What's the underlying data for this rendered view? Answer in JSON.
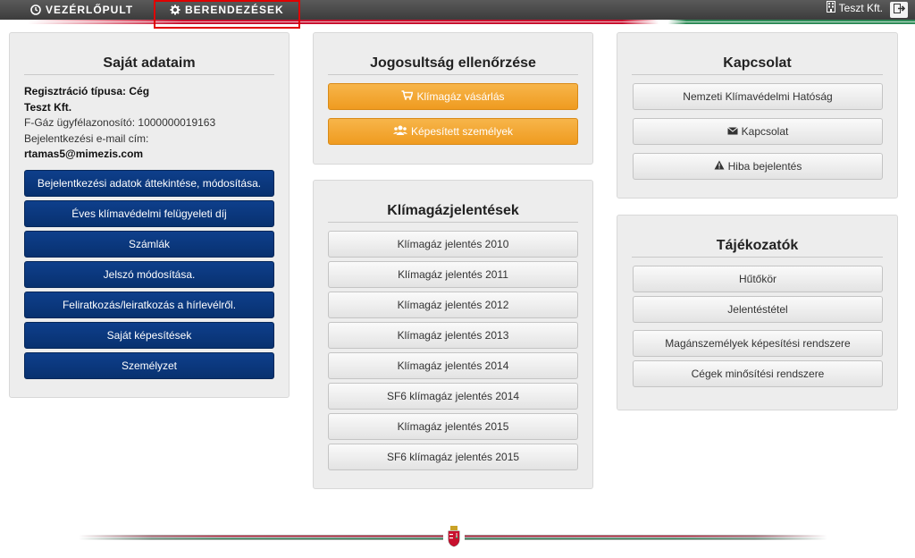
{
  "nav": {
    "dashboard_label": "VEZÉRLŐPULT",
    "equipment_label": "BERENDEZÉSEK",
    "company_name": "Teszt Kft."
  },
  "own_data": {
    "title": "Saját adataim",
    "reg_type": "Regisztráció típusa: Cég",
    "company": "Teszt Kft.",
    "fgas_id": "F-Gáz ügyfélazonosító: 1000000019163",
    "email_label": "Bejelentkezési e-mail cím:",
    "email": "rtamas5@mimezis.com",
    "buttons": [
      "Bejelentkezési adatok áttekintése, módosítása.",
      "Éves klímavédelmi felügyeleti díj",
      "Számlák",
      "Jelszó módosítása.",
      "Feliratkozás/leiratkozás a hírlevélről.",
      "Saját képesítések",
      "Személyzet"
    ]
  },
  "eligibility": {
    "title": "Jogosultság ellenőrzése",
    "buttons": [
      "Klímagáz vásárlás",
      "Képesített személyek"
    ]
  },
  "reports": {
    "title": "Klímagázjelentések",
    "buttons": [
      "Klímagáz jelentés 2010",
      "Klímagáz jelentés 2011",
      "Klímagáz jelentés 2012",
      "Klímagáz jelentés 2013",
      "Klímagáz jelentés 2014",
      "SF6 klímagáz jelentés 2014",
      "Klímagáz jelentés 2015",
      "SF6 klímagáz jelentés 2015"
    ]
  },
  "contact": {
    "title": "Kapcsolat",
    "buttons": [
      "Nemzeti Klímavédelmi Hatóság",
      "Kapcsolat",
      "Hiba bejelentés"
    ]
  },
  "info": {
    "title": "Tájékozatók",
    "buttons": [
      "Hűtőkör",
      "Jelentéstétel",
      "Magánszemélyek képesítési rendszere",
      "Cégek minősítési rendszere"
    ]
  },
  "colors": {
    "primary_dark": "#08316f",
    "orange": "#ef9b20",
    "red": "#c8102e",
    "green": "#2e8b57"
  }
}
